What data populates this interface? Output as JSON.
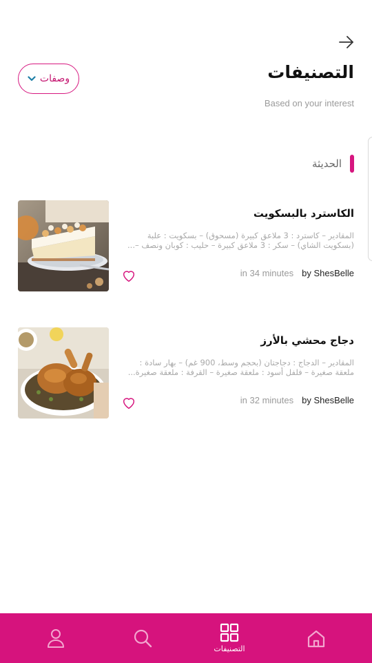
{
  "header": {
    "title": "التصنيفات",
    "subtitle": "Based on your interest",
    "dropdown_label": "وصفات"
  },
  "section": {
    "title": "الحديثة"
  },
  "recipes": [
    {
      "title": "الكاسترد بالبسكويت",
      "description": "المقادير – كاسترد : 3 ملاعق كبيرة (مسحوق) – بسكويت : علبة (بسكويت الشاي) – سكر : 3 ملاعق كبيرة – حليب : كوبان ونصف –...",
      "time": "in 34 minutes",
      "author": "by ShesBelle"
    },
    {
      "title": "دجاج محشي بالأرز",
      "description": "المقادير – الدجاج : دجاجتان (بحجم وسط، 900 غم) – بهار سادة : ملعقة صغيرة – فلفل أسود : ملعقة صغيرة – القرفة : ملعقة صغيرة...",
      "time": "in 32 minutes",
      "author": "by ShesBelle"
    }
  ],
  "bottom_nav": {
    "active_label": "التصنيفات",
    "items": [
      "profile-icon",
      "search-icon",
      "categories-icon",
      "home-icon"
    ]
  },
  "colors": {
    "accent": "#d6137d"
  }
}
